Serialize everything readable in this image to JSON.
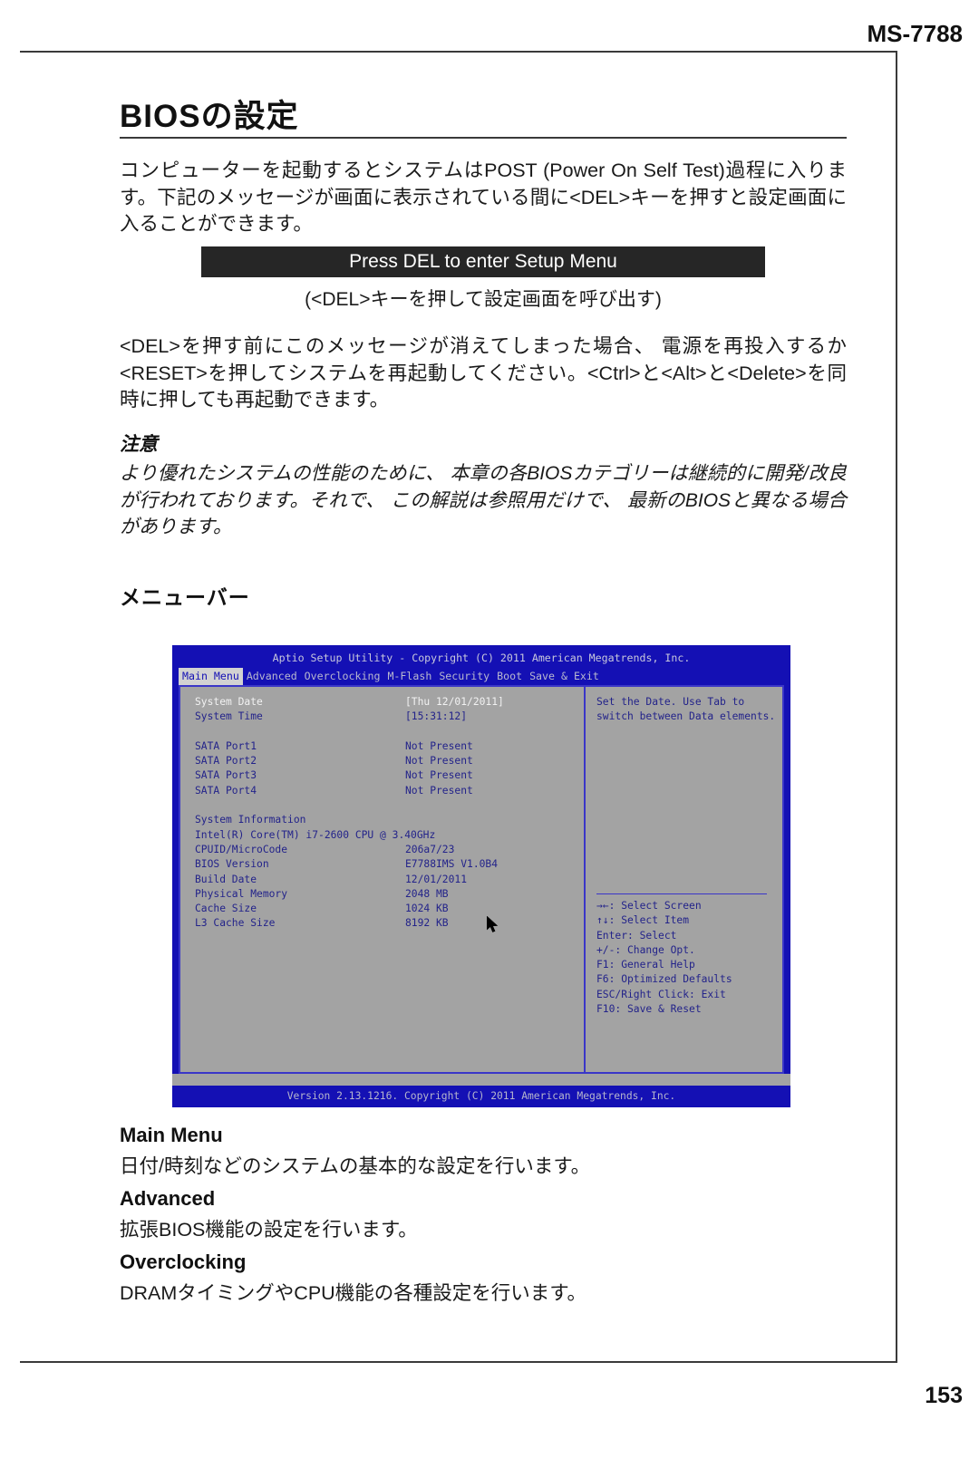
{
  "page": {
    "model": "MS-7788",
    "number": "153"
  },
  "chapter": {
    "title": "BIOSの設定"
  },
  "intro": {
    "paragraph": "コンピューターを起動するとシステムはPOST (Power On Self Test)過程に入ります。下記のメッセージが画面に表示されている間に<DEL>キーを押すと設定画面に入ることができます。"
  },
  "banner": {
    "text": "Press DEL to enter Setup Menu",
    "caption": "(<DEL>キーを押して設定画面を呼び出す)"
  },
  "restart": {
    "paragraph": "<DEL>を押す前にこのメッセージが消えてしまった場合、 電源を再投入するか<RESET>を押してシステムを再起動してください。<Ctrl>と<Alt>と<Delete>を同時に押しても再起動できます。"
  },
  "note": {
    "heading": "注意",
    "body": "より優れたシステムの性能のために、 本章の各BIOSカテゴリーは継続的に開発/改良が行われております。それで、 この解説は参照用だけで、 最新のBIOSと異なる場合があります。"
  },
  "menubar_section": {
    "heading": "メニューバー"
  },
  "bios": {
    "title": "Aptio Setup Utility - Copyright (C) 2011 American Megatrends, Inc.",
    "tabs": [
      {
        "label": "Main Menu",
        "active": true
      },
      {
        "label": "Advanced",
        "active": false
      },
      {
        "label": "Overclocking",
        "active": false
      },
      {
        "label": "M-Flash",
        "active": false
      },
      {
        "label": "Security",
        "active": false
      },
      {
        "label": "Boot",
        "active": false
      },
      {
        "label": "Save & Exit",
        "active": false
      }
    ],
    "rows": {
      "system_date_label": "System Date",
      "system_date_value": "[Thu 12/01/2011]",
      "system_time_label": "System Time",
      "system_time_value": "[15:31:12]",
      "sata1_label": "SATA Port1",
      "sata1_value": "Not Present",
      "sata2_label": "SATA Port2",
      "sata2_value": "Not Present",
      "sata3_label": "SATA Port3",
      "sata3_value": "Not Present",
      "sata4_label": "SATA Port4",
      "sata4_value": "Not Present",
      "sysinfo_header": "System Information",
      "cpu_line": "Intel(R) Core(TM) i7-2600 CPU @ 3.40GHz",
      "cpuid_label": "CPUID/MicroCode",
      "cpuid_value": "206a7/23",
      "bios_version_label": "BIOS Version",
      "bios_version_value": "E7788IMS V1.0B4",
      "build_date_label": "Build Date",
      "build_date_value": "12/01/2011",
      "physical_memory_label": "Physical Memory",
      "physical_memory_value": "2048 MB",
      "cache_size_label": "Cache Size",
      "cache_size_value": "1024 KB",
      "l3_cache_label": "L3 Cache Size",
      "l3_cache_value": "8192 KB"
    },
    "help": {
      "description": "Set the Date. Use Tab to\nswitch between Data elements.",
      "keys": "→←: Select Screen\n↑↓: Select Item\nEnter: Select\n+/-: Change Opt.\nF1: General Help\nF6: Optimized Defaults\nESC/Right Click: Exit\nF10: Save & Reset"
    },
    "footer": "Version 2.13.1216. Copyright (C) 2011 American Megatrends, Inc.",
    "colors": {
      "background": "#1410b4",
      "panel": "#a3a3a3",
      "border": "#3a36c8",
      "label": "#23238a",
      "selected": "#f2f2f2",
      "tab_active_bg": "#d2d2d2"
    }
  },
  "descriptions": [
    {
      "heading": "Main Menu",
      "text": "日付/時刻などのシステムの基本的な設定を行います。"
    },
    {
      "heading": "Advanced",
      "text": "拡張BIOS機能の設定を行います。"
    },
    {
      "heading": "Overclocking",
      "text": "DRAMタイミングやCPU機能の各種設定を行います。"
    }
  ]
}
